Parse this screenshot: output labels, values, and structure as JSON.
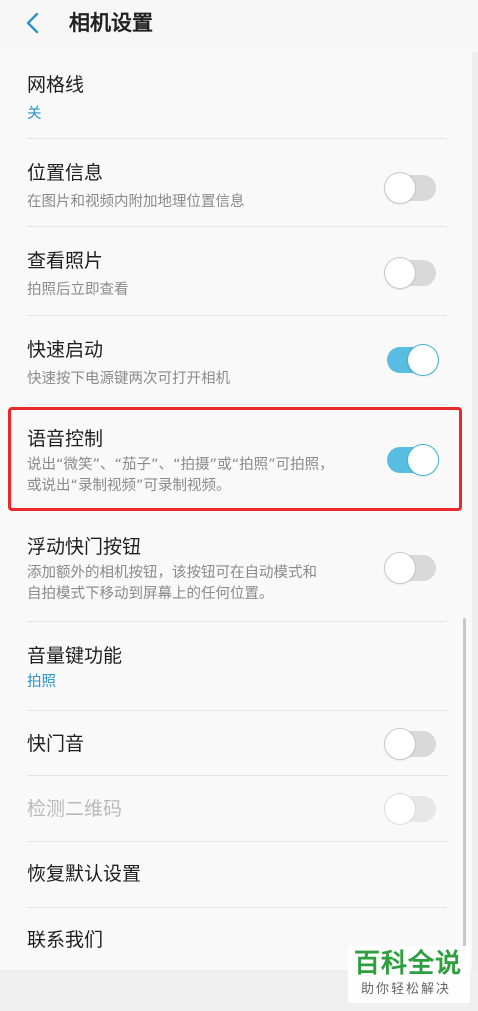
{
  "header": {
    "title": "相机设置",
    "back_icon": "chevron-left-icon"
  },
  "settings": {
    "grid": {
      "title": "网格线",
      "value": "关"
    },
    "location": {
      "title": "位置信息",
      "subtitle": "在图片和视频内附加地理位置信息",
      "enabled": false
    },
    "review": {
      "title": "查看照片",
      "subtitle": "拍照后立即查看",
      "enabled": false
    },
    "quick_launch": {
      "title": "快速启动",
      "subtitle": "快速按下电源键两次可打开相机",
      "enabled": true
    },
    "voice_control": {
      "title": "语音控制",
      "subtitle_line1": "说出“微笑”、“茄子”、“拍摄”或“拍照”可拍照，",
      "subtitle_line2": "或说出“录制视频”可录制视频。",
      "enabled": true
    },
    "floating_shutter": {
      "title": "浮动快门按钮",
      "subtitle_line1": "添加额外的相机按钮，该按钮可在自动模式和",
      "subtitle_line2": "自拍模式下移动到屏幕上的任何位置。",
      "enabled": false
    },
    "volume_key": {
      "title": "音量键功能",
      "value": "拍照"
    },
    "shutter_sound": {
      "title": "快门音",
      "enabled": false
    },
    "qr_detect": {
      "title": "检测二维码",
      "enabled": false,
      "disabled": true
    },
    "reset": {
      "title": "恢复默认设置"
    },
    "contact": {
      "title": "联系我们"
    }
  },
  "watermark": {
    "title": "百科全说",
    "subtitle": "助你轻松解决"
  },
  "colors": {
    "accent": "#58bde0",
    "value_blue": "#2a93c7",
    "highlight_red": "#ea2a2a",
    "watermark_green": "#2e9e3f"
  }
}
